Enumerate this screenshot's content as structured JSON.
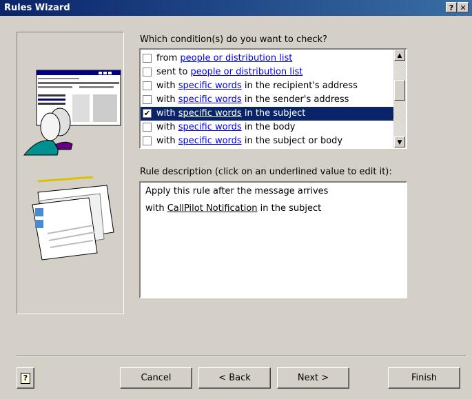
{
  "window": {
    "title": "Rules Wizard",
    "help_glyph": "?",
    "close_glyph": "✕"
  },
  "conditions": {
    "prompt": "Which condition(s) do you want to check?",
    "items": [
      {
        "before": "from ",
        "link": "people or distribution list",
        "after": "",
        "checked": false,
        "selected": false
      },
      {
        "before": "sent to ",
        "link": "people or distribution list",
        "after": "",
        "checked": false,
        "selected": false
      },
      {
        "before": "with ",
        "link": "specific words",
        "after": " in the recipient's address",
        "checked": false,
        "selected": false
      },
      {
        "before": "with ",
        "link": "specific words",
        "after": " in the sender's address",
        "checked": false,
        "selected": false
      },
      {
        "before": "with ",
        "link": "specific words",
        "after": " in the subject",
        "checked": true,
        "selected": true
      },
      {
        "before": "with ",
        "link": "specific words",
        "after": " in the body",
        "checked": false,
        "selected": false
      },
      {
        "before": "with ",
        "link": "specific words",
        "after": " in the subject or body",
        "checked": false,
        "selected": false
      }
    ]
  },
  "description": {
    "label": "Rule description (click on an underlined value to edit it):",
    "line1": "Apply this rule after the message arrives",
    "line2_before": "with ",
    "line2_link": "CallPilot Notification",
    "line2_after": " in the subject"
  },
  "buttons": {
    "help": "?",
    "cancel": "Cancel",
    "back": "< Back",
    "next": "Next >",
    "finish": "Finish"
  },
  "colors": {
    "title_bar": "#0a246a",
    "selection": "#0a246a",
    "link": "#0000ee",
    "face": "#d4d0c8"
  }
}
